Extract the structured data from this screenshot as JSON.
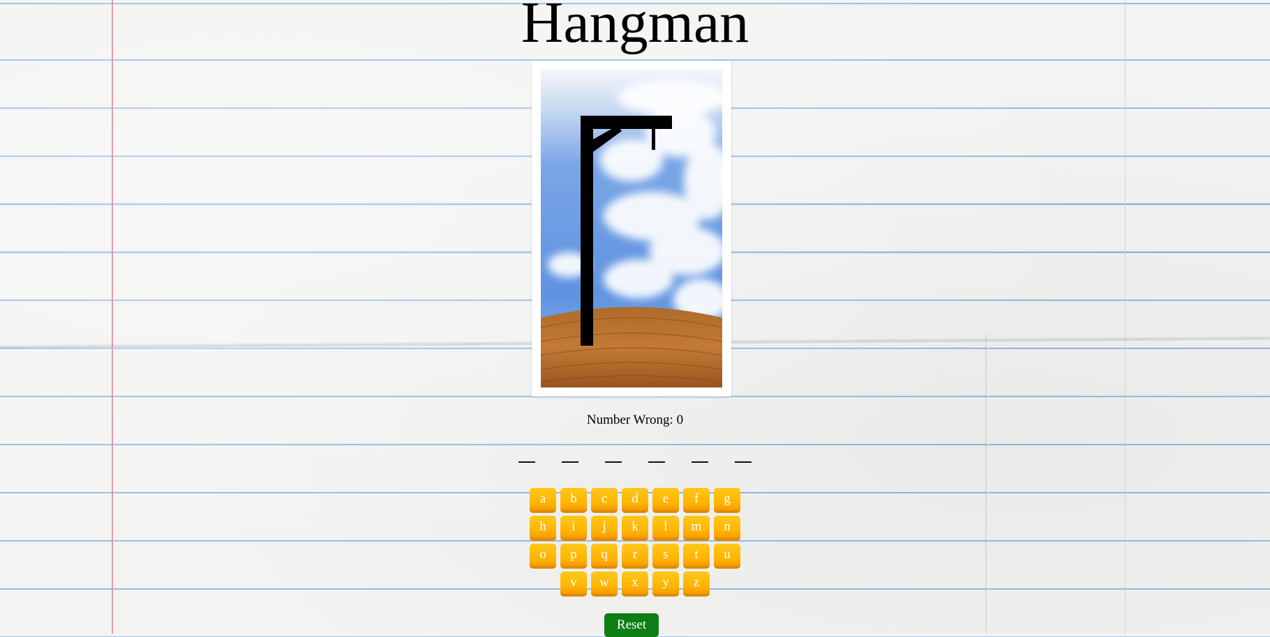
{
  "title": "Hangman",
  "status": {
    "wrong_label": "Number Wrong: 0",
    "wrong_count": 0
  },
  "word": {
    "length": 6,
    "revealed": [
      "",
      "",
      "",
      "",
      "",
      ""
    ]
  },
  "keyboard": {
    "rows": [
      [
        "a",
        "b",
        "c",
        "d",
        "e",
        "f",
        "g"
      ],
      [
        "h",
        "i",
        "j",
        "k",
        "l",
        "m",
        "n"
      ],
      [
        "o",
        "p",
        "q",
        "r",
        "s",
        "t",
        "u"
      ],
      [
        "v",
        "w",
        "x",
        "y",
        "z"
      ]
    ]
  },
  "reset_label": "Reset",
  "colors": {
    "key": "#ffb300",
    "reset": "#0d7e14",
    "paper_line": "#8fb4e3",
    "margin": "#e39aa6"
  }
}
